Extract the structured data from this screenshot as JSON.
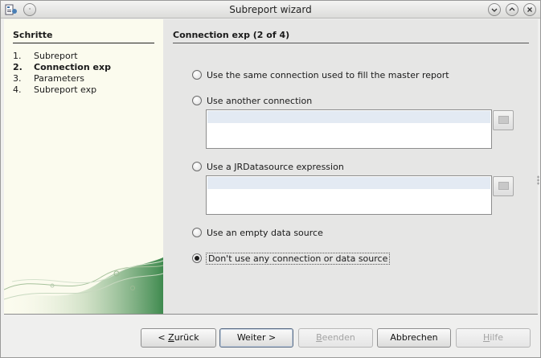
{
  "window": {
    "title": "Subreport wizard",
    "controls": [
      "minimize-icon",
      "maximize-icon",
      "close-icon"
    ]
  },
  "steps": {
    "title": "Schritte",
    "items": [
      {
        "num": "1.",
        "label": "Subreport",
        "active": false
      },
      {
        "num": "2.",
        "label": "Connection exp",
        "active": true
      },
      {
        "num": "3.",
        "label": "Parameters",
        "active": false
      },
      {
        "num": "4.",
        "label": "Subreport exp",
        "active": false
      }
    ]
  },
  "content": {
    "title": "Connection exp (2 of 4)",
    "options": {
      "same_connection": "Use the same connection used to fill the master report",
      "another_connection": "Use another connection",
      "jr_datasource": "Use a JRDatasource expression",
      "empty_datasource": "Use an empty data source",
      "no_connection": "Don't use any connection or data source"
    },
    "selected_option": "no_connection"
  },
  "buttons": {
    "back": {
      "prefix": "< ",
      "mnemonic": "Z",
      "rest": "urück"
    },
    "next": "Weiter >",
    "finish": {
      "mnemonic": "B",
      "rest": "eenden"
    },
    "cancel": "Abbrechen",
    "help": {
      "mnemonic": "H",
      "rest": "ilfe"
    }
  }
}
